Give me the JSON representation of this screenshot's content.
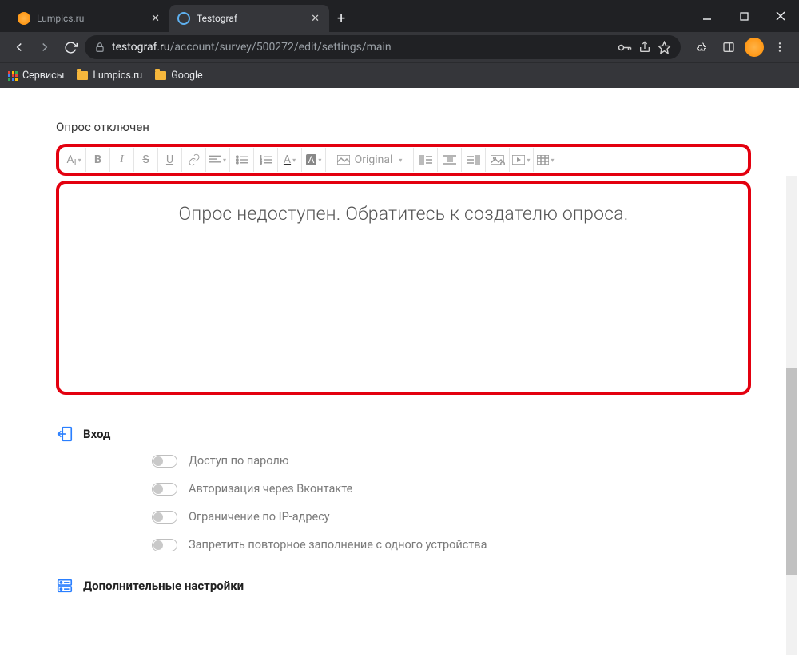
{
  "window": {
    "tab1_label": "Lumpics.ru",
    "tab2_label": "Testograf",
    "min_icon": "minimize",
    "max_icon": "maximize",
    "close_icon": "close"
  },
  "toolbar": {
    "url_domain": "testograf.ru",
    "url_path": "/account/survey/500272/edit/settings/main"
  },
  "bookmarks": {
    "apps_label": "Сервисы",
    "bm1_label": "Lumpics.ru",
    "bm2_label": "Google"
  },
  "page": {
    "disabled_label": "Опрос отключен",
    "editor_text": "Опрос недоступен. Обратитесь к создателю опроса.",
    "toolbar_original": "Original",
    "section_vhod_title": "Вход",
    "toggle1_label": "Доступ по паролю",
    "toggle2_label": "Авторизация через Вконтакте",
    "toggle3_label": "Ограничение по IP-адресу",
    "toggle4_label": "Запретить повторное заполнение с одного устройства",
    "section_extra_title": "Дополнительные настройки"
  }
}
